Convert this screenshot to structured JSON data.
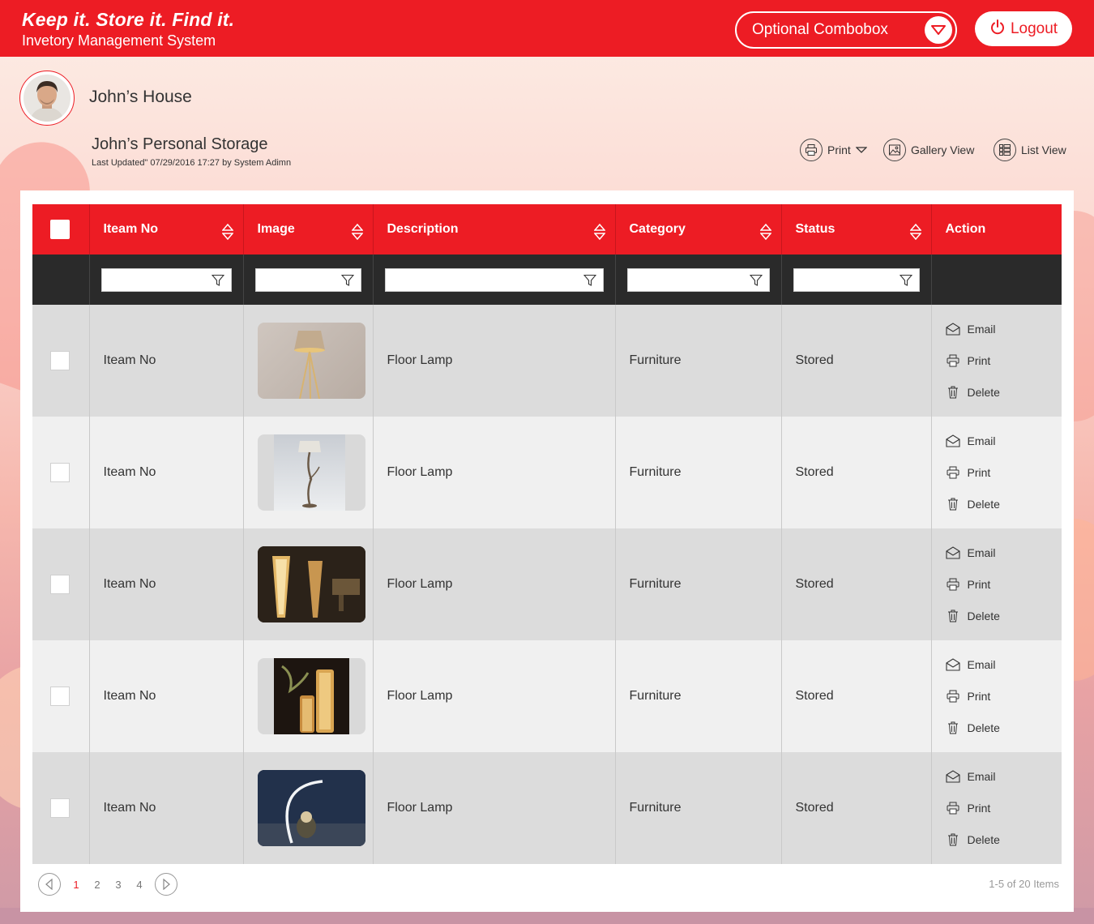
{
  "header": {
    "tagline": "Keep it. Store it. Find it.",
    "subtitle": "Invetory Management System",
    "combobox_label": "Optional Combobox",
    "logout_label": "Logout"
  },
  "profile": {
    "house_name": "John’s House",
    "storage_name": "John’s Personal Storage",
    "last_updated": "Last Updated\" 07/29/2016 17:27 by System Adimn"
  },
  "toolbar": {
    "print_label": "Print",
    "gallery_label": "Gallery View",
    "list_label": "List View"
  },
  "table": {
    "columns": [
      "Iteam No",
      "Image",
      "Description",
      "Category",
      "Status",
      "Action"
    ],
    "rows": [
      {
        "item_no": "Iteam No",
        "description": "Floor Lamp",
        "category": "Furniture",
        "status": "Stored",
        "image": "floor-lamp-tripod"
      },
      {
        "item_no": "Iteam No",
        "description": "Floor Lamp",
        "category": "Furniture",
        "status": "Stored",
        "image": "floor-lamp-branch"
      },
      {
        "item_no": "Iteam No",
        "description": "Floor Lamp",
        "category": "Furniture",
        "status": "Stored",
        "image": "floor-lamp-slat"
      },
      {
        "item_no": "Iteam No",
        "description": "Floor Lamp",
        "category": "Furniture",
        "status": "Stored",
        "image": "floor-lamp-cylinder"
      },
      {
        "item_no": "Iteam No",
        "description": "Floor Lamp",
        "category": "Furniture",
        "status": "Stored",
        "image": "floor-lamp-arc"
      }
    ],
    "actions": {
      "email": "Email",
      "print": "Print",
      "delete": "Delete"
    }
  },
  "pagination": {
    "pages": [
      "1",
      "2",
      "3",
      "4"
    ],
    "current": "1",
    "summary": "1-5 of 20 Items"
  },
  "colors": {
    "brand": "#ed1c24",
    "filter_bar": "#2a2a2a"
  }
}
